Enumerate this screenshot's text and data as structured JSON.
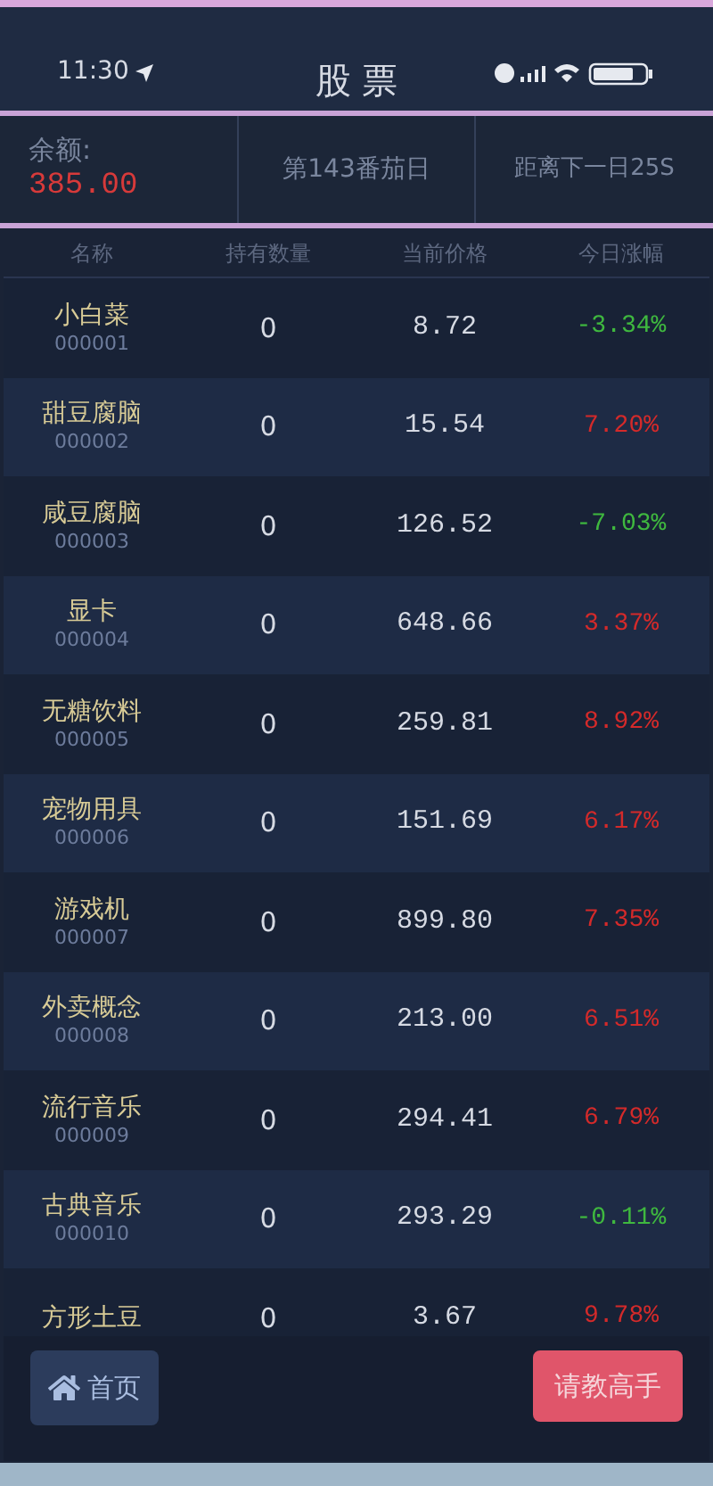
{
  "status_bar": {
    "time": "11:30"
  },
  "title": "股 票",
  "info_bar": {
    "balance_label": "余额:",
    "balance": "385.00",
    "day": "第143番茄日",
    "countdown": "距离下一日25S"
  },
  "table": {
    "columns": [
      "名称",
      "持有数量",
      "当前价格",
      "今日涨幅"
    ],
    "rows": [
      {
        "name": "小白菜",
        "code": "000001",
        "quantity": "0",
        "price": "8.72",
        "change": "-3.34%",
        "color": "#3fb83f"
      },
      {
        "name": "甜豆腐脑",
        "code": "000002",
        "quantity": "0",
        "price": "15.54",
        "change": "7.20%",
        "color": "#d42a2a"
      },
      {
        "name": "咸豆腐脑",
        "code": "000003",
        "quantity": "0",
        "price": "126.52",
        "change": "-7.03%",
        "color": "#3fb83f"
      },
      {
        "name": "显卡",
        "code": "000004",
        "quantity": "0",
        "price": "648.66",
        "change": "3.37%",
        "color": "#d42a2a"
      },
      {
        "name": "无糖饮料",
        "code": "000005",
        "quantity": "0",
        "price": "259.81",
        "change": "8.92%",
        "color": "#d42a2a"
      },
      {
        "name": "宠物用具",
        "code": "000006",
        "quantity": "0",
        "price": "151.69",
        "change": "6.17%",
        "color": "#d42a2a"
      },
      {
        "name": "游戏机",
        "code": "000007",
        "quantity": "0",
        "price": "899.80",
        "change": "7.35%",
        "color": "#d42a2a"
      },
      {
        "name": "外卖概念",
        "code": "000008",
        "quantity": "0",
        "price": "213.00",
        "change": "6.51%",
        "color": "#d42a2a"
      },
      {
        "name": "流行音乐",
        "code": "000009",
        "quantity": "0",
        "price": "294.41",
        "change": "6.79%",
        "color": "#d42a2a"
      },
      {
        "name": "古典音乐",
        "code": "000010",
        "quantity": "0",
        "price": "293.29",
        "change": "-0.11%",
        "color": "#3fb83f"
      },
      {
        "name": "方形土豆",
        "quantity": "0",
        "price": "3.67",
        "change": "9.78%",
        "color": "#d42a2a"
      }
    ]
  },
  "footer": {
    "home_button": "首页",
    "help_button": "请教高手"
  }
}
